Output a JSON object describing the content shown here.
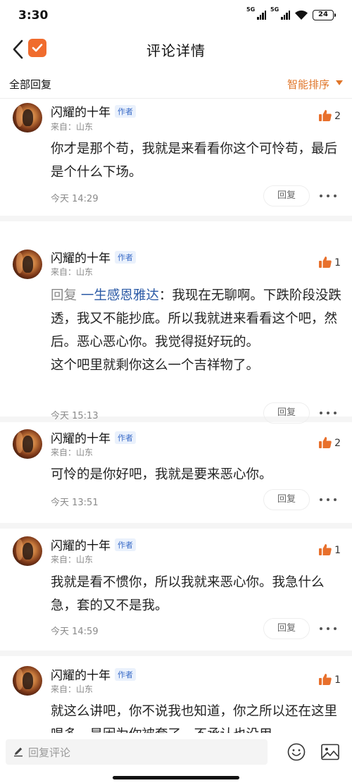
{
  "status_bar": {
    "time": "3:30",
    "network_1": "5G",
    "network_2": "5G",
    "battery": "24"
  },
  "header": {
    "title": "评论详情",
    "back_icon": "chevron-left-icon",
    "app_icon": "checkbox-app-icon"
  },
  "sub_header": {
    "all_replies": "全部回复",
    "sort_label": "智能排序",
    "sort_icon": "caret-down-icon"
  },
  "colors": {
    "accent": "#e0762a",
    "link": "#2b5aa6",
    "author_tag_bg": "#eaf1fc"
  },
  "comments": [
    {
      "username": "闪耀的十年",
      "author_tag": "作者",
      "location": "来自：山东",
      "likes": "2",
      "reply_prefix": "",
      "reply_to": "",
      "text": "你才是那个苟，我就是来看看你这个可怜苟，最后是个什么下场。",
      "time": "今天 14:29",
      "reply_label": "回复"
    },
    {
      "username": "闪耀的十年",
      "author_tag": "作者",
      "location": "来自：山东",
      "likes": "1",
      "reply_prefix": "回复 ",
      "reply_to": "一生感恩雅达",
      "text": "：我现在无聊啊。下跌阶段没跌透，我又不能抄底。所以我就进来看看这个吧，然后。恶心恶心你。我觉得挺好玩的。\n这个吧里就剩你这么一个吉祥物了。",
      "time": "今天 15:13",
      "reply_label": "回复"
    },
    {
      "username": "闪耀的十年",
      "author_tag": "作者",
      "location": "来自：山东",
      "likes": "2",
      "reply_prefix": "",
      "reply_to": "",
      "text": "可怜的是你好吧，我就是要来恶心你。",
      "time": "今天 13:51",
      "reply_label": "回复"
    },
    {
      "username": "闪耀的十年",
      "author_tag": "作者",
      "location": "来自：山东",
      "likes": "1",
      "reply_prefix": "",
      "reply_to": "",
      "text": "我就是看不惯你，所以我就来恶心你。我急什么急，套的又不是我。",
      "time": "今天 14:59",
      "reply_label": "回复"
    },
    {
      "username": "闪耀的十年",
      "author_tag": "作者",
      "location": "来自：山东",
      "likes": "1",
      "reply_prefix": "",
      "reply_to": "",
      "text": "就这么讲吧，你不说我也知道，你之所以还在这里唱多，是因为你被套了，不承认也没用",
      "time": "",
      "reply_label": ""
    }
  ],
  "bottom_bar": {
    "input_placeholder": "回复评论",
    "emoji_icon": "smiley-icon",
    "image_icon": "image-icon"
  }
}
